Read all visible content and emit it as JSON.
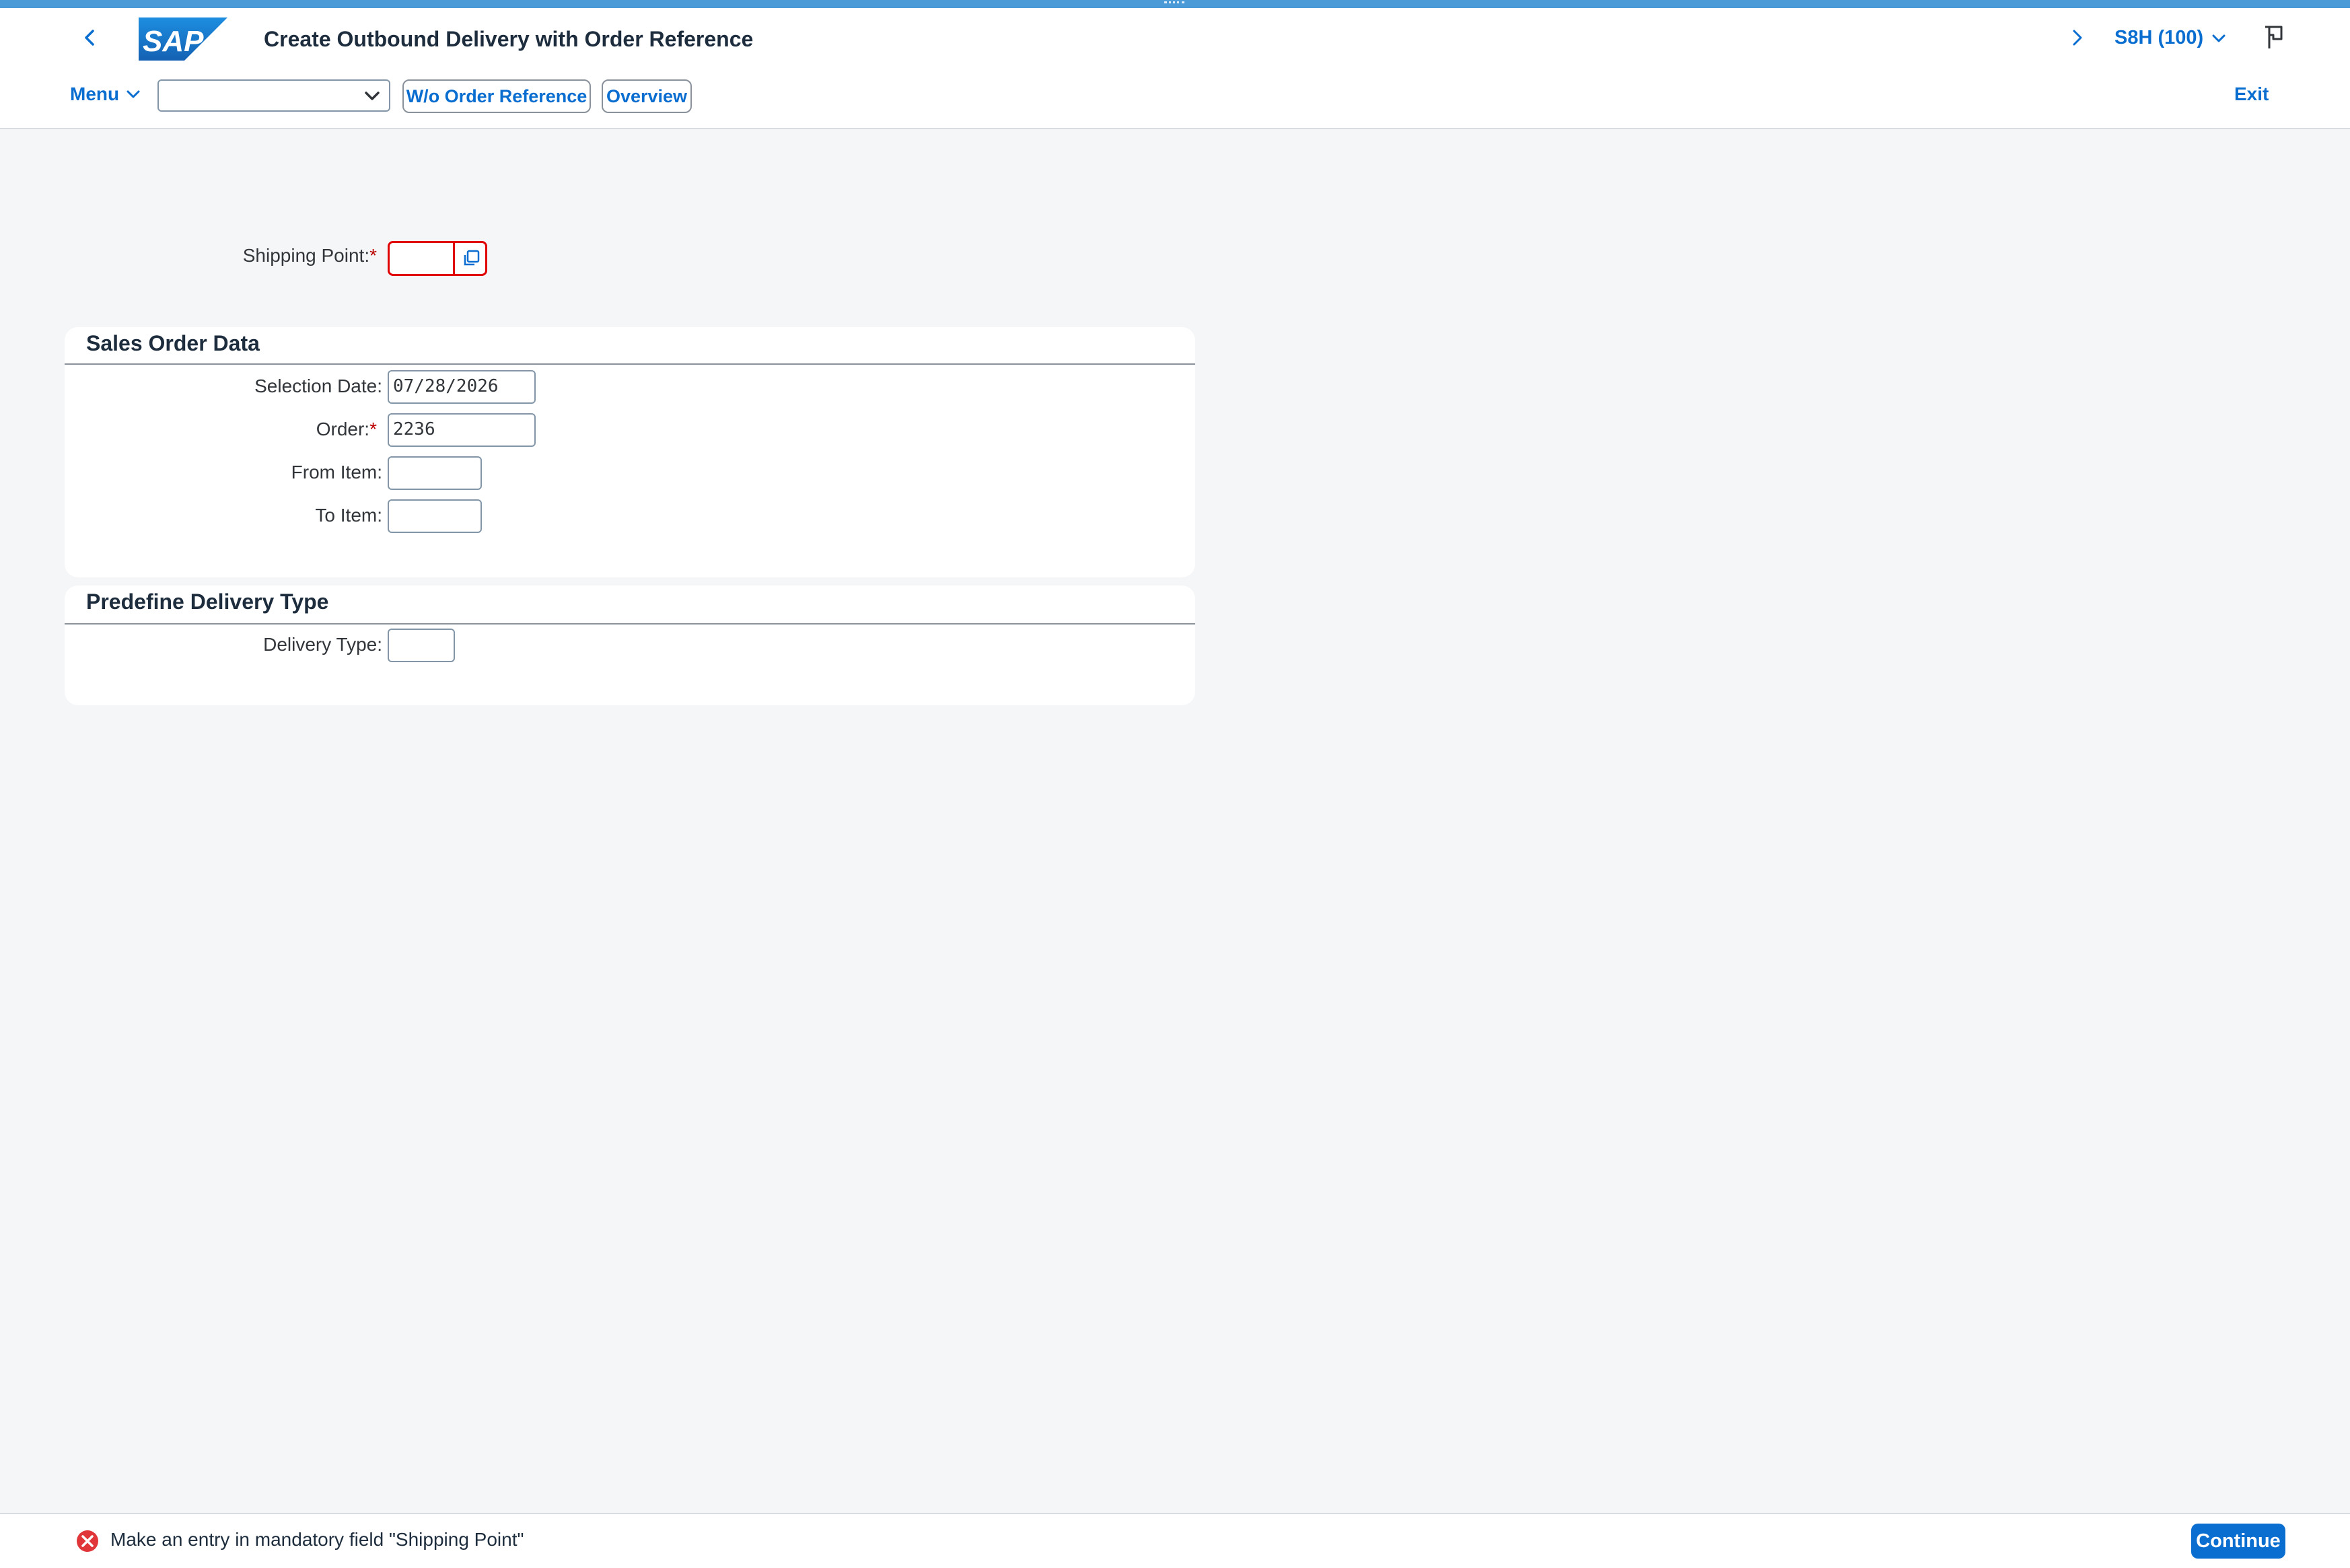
{
  "shell": {
    "title": "Create Outbound Delivery with Order Reference",
    "system": "S8H (100)",
    "logo_text": "SAP"
  },
  "toolbar": {
    "menu_label": "Menu",
    "command_field_value": "",
    "wo_order_reference_label": "W/o Order Reference",
    "overview_label": "Overview",
    "exit_label": "Exit"
  },
  "form": {
    "shipping_point": {
      "label": "Shipping Point:",
      "required_marker": "*",
      "value": ""
    },
    "sales_order_data": {
      "title": "Sales Order Data",
      "selection_date": {
        "label": "Selection Date:",
        "value": "07/28/2026"
      },
      "order": {
        "label": "Order:",
        "required_marker": "*",
        "value": "2236"
      },
      "from_item": {
        "label": "From Item:",
        "value": ""
      },
      "to_item": {
        "label": "To Item:",
        "value": ""
      }
    },
    "predefine_delivery_type": {
      "title": "Predefine Delivery Type",
      "delivery_type": {
        "label": "Delivery Type:",
        "value": ""
      }
    }
  },
  "footer": {
    "message": "Make an entry in mandatory field \"Shipping Point\"",
    "message_type": "error",
    "continue_label": "Continue"
  },
  "colors": {
    "brand_blue": "#0a6ed1",
    "error_red": "#e00000",
    "top_strip": "#4a9ad7",
    "background": "#f5f6f7"
  }
}
